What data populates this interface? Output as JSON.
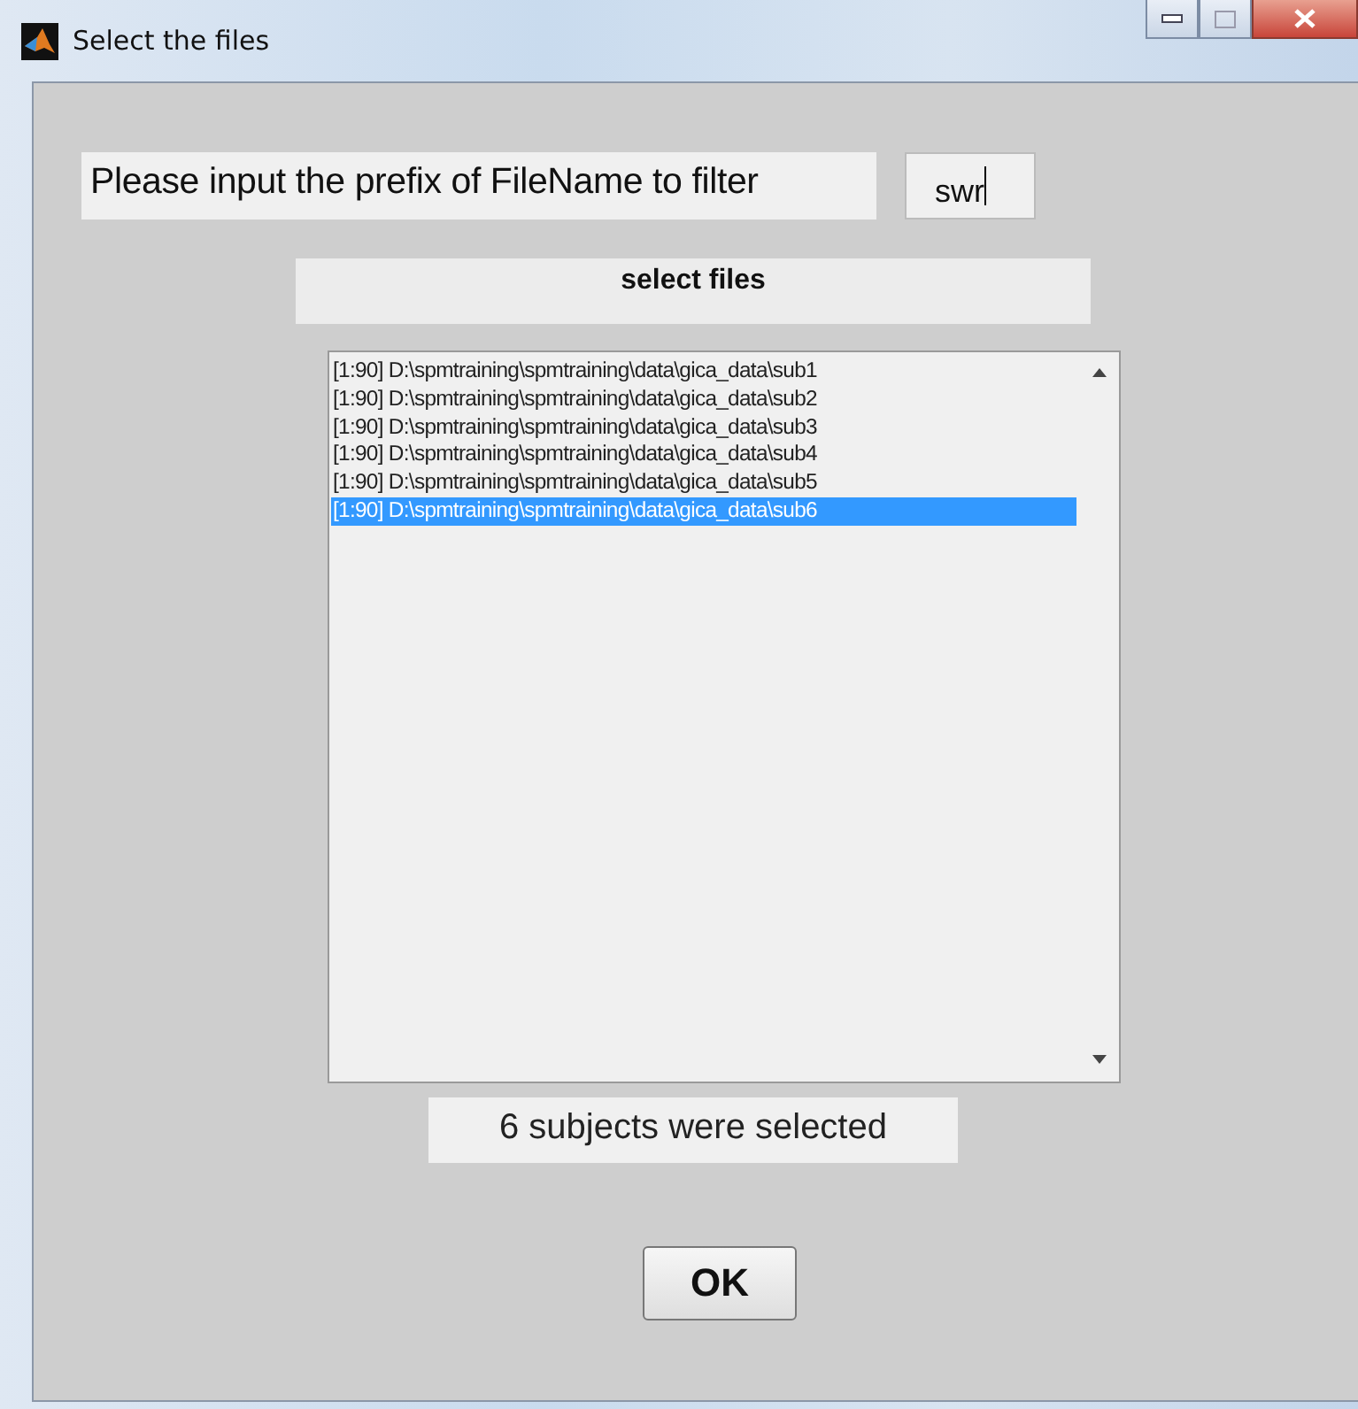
{
  "window": {
    "title": "Select the files"
  },
  "prompt": {
    "label": "Please input the prefix of FileName to filter",
    "value": "swr"
  },
  "list_header": "select files",
  "files": [
    {
      "text": "[1:90] D:\\spmtraining\\spmtraining\\data\\gica_data\\sub1",
      "selected": false
    },
    {
      "text": "[1:90] D:\\spmtraining\\spmtraining\\data\\gica_data\\sub2",
      "selected": false
    },
    {
      "text": "[1:90] D:\\spmtraining\\spmtraining\\data\\gica_data\\sub3",
      "selected": false
    },
    {
      "text": "[1:90] D:\\spmtraining\\spmtraining\\data\\gica_data\\sub4",
      "selected": false
    },
    {
      "text": "[1:90] D:\\spmtraining\\spmtraining\\data\\gica_data\\sub5",
      "selected": false
    },
    {
      "text": "[1:90] D:\\spmtraining\\spmtraining\\data\\gica_data\\sub6",
      "selected": true
    }
  ],
  "status": "6 subjects were selected",
  "buttons": [
    "OK"
  ]
}
